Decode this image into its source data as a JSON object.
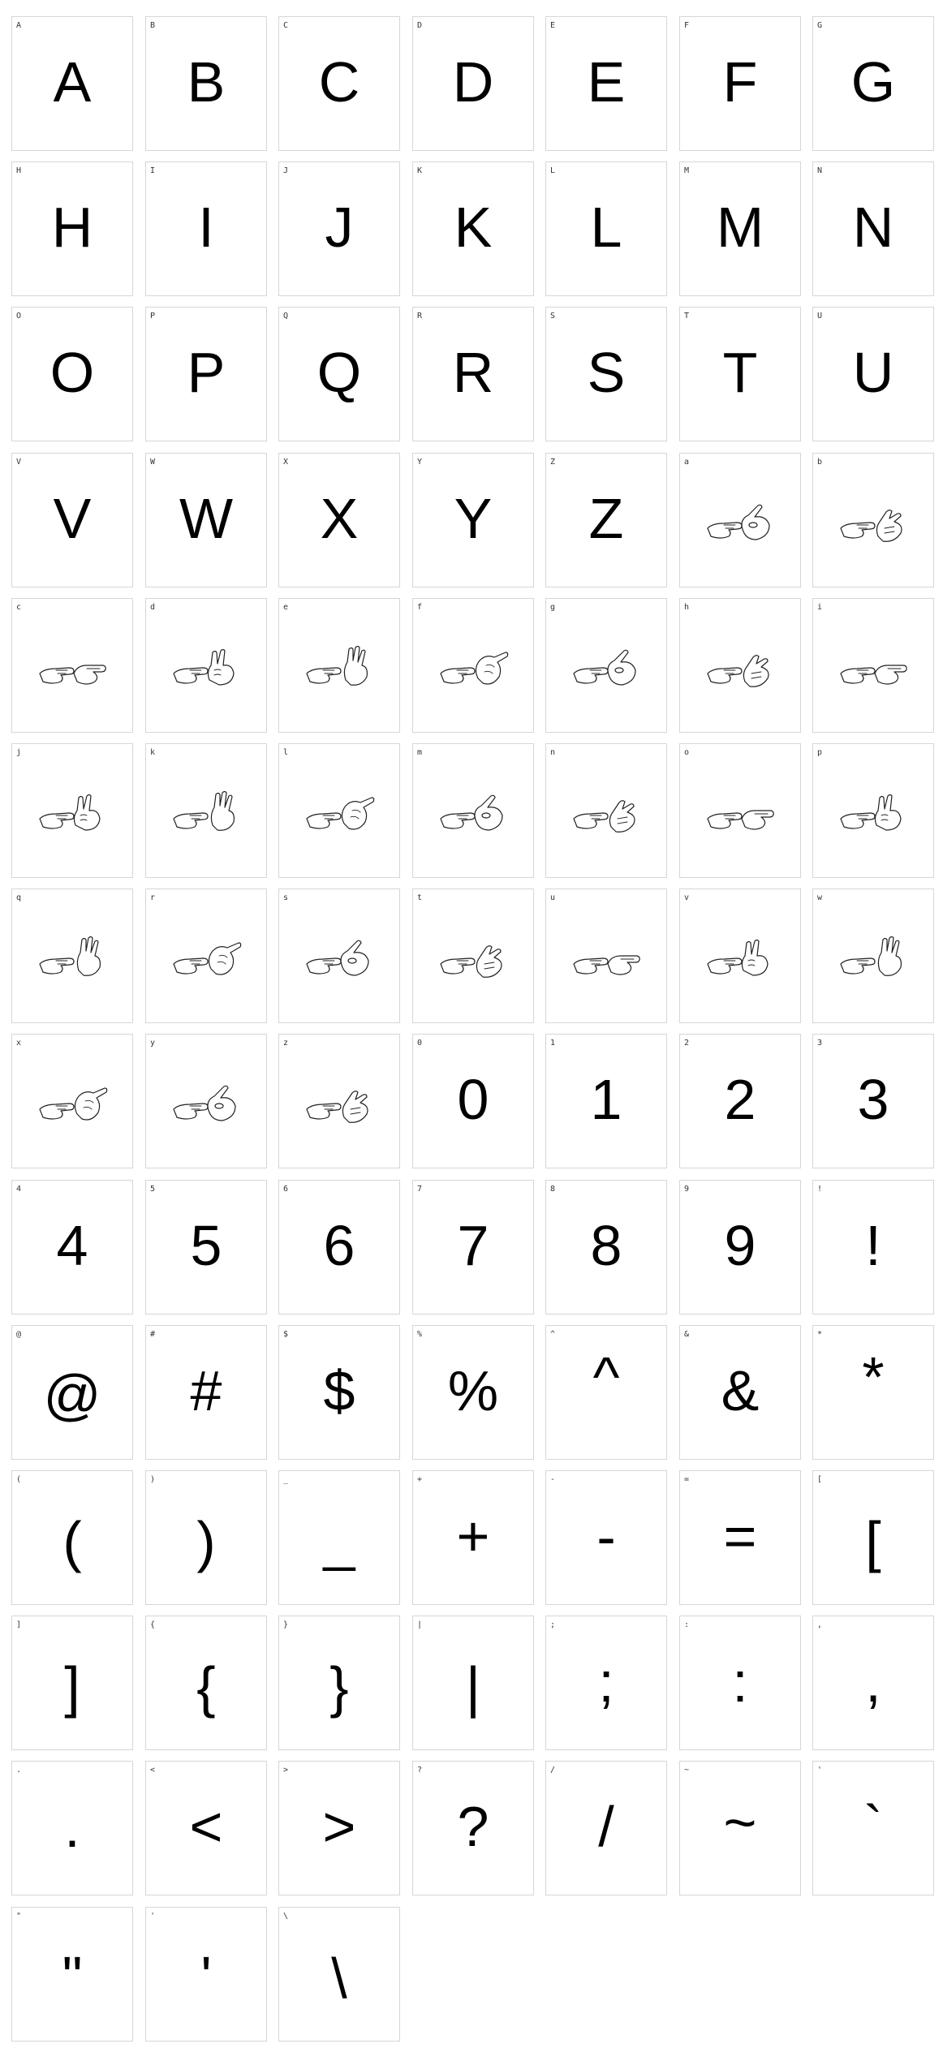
{
  "colors": {
    "background": "#ffffff",
    "cell_border": "#d6d6d6",
    "glyph": "#000000",
    "label": "#333333"
  },
  "cells": [
    {
      "label": "A",
      "glyph": "A"
    },
    {
      "label": "B",
      "glyph": "B"
    },
    {
      "label": "C",
      "glyph": "C"
    },
    {
      "label": "D",
      "glyph": "D"
    },
    {
      "label": "E",
      "glyph": "E"
    },
    {
      "label": "F",
      "glyph": "F"
    },
    {
      "label": "G",
      "glyph": "G"
    },
    {
      "label": "H",
      "glyph": "H"
    },
    {
      "label": "I",
      "glyph": "I"
    },
    {
      "label": "J",
      "glyph": "J"
    },
    {
      "label": "K",
      "glyph": "K"
    },
    {
      "label": "L",
      "glyph": "L"
    },
    {
      "label": "M",
      "glyph": "M"
    },
    {
      "label": "N",
      "glyph": "N"
    },
    {
      "label": "O",
      "glyph": "O"
    },
    {
      "label": "P",
      "glyph": "P"
    },
    {
      "label": "Q",
      "glyph": "Q"
    },
    {
      "label": "R",
      "glyph": "R"
    },
    {
      "label": "S",
      "glyph": "S"
    },
    {
      "label": "T",
      "glyph": "T"
    },
    {
      "label": "U",
      "glyph": "U"
    },
    {
      "label": "V",
      "glyph": "V"
    },
    {
      "label": "W",
      "glyph": "W"
    },
    {
      "label": "X",
      "glyph": "X"
    },
    {
      "label": "Y",
      "glyph": "Y"
    },
    {
      "label": "Z",
      "glyph": "Z"
    },
    {
      "label": "a",
      "icon": "hand-sign-a-icon"
    },
    {
      "label": "b",
      "icon": "hand-sign-b-icon"
    },
    {
      "label": "c",
      "icon": "hand-sign-c-icon"
    },
    {
      "label": "d",
      "icon": "hand-sign-d-icon"
    },
    {
      "label": "e",
      "icon": "hand-sign-e-icon"
    },
    {
      "label": "f",
      "icon": "hand-sign-f-icon"
    },
    {
      "label": "g",
      "icon": "hand-sign-g-icon"
    },
    {
      "label": "h",
      "icon": "hand-sign-h-icon"
    },
    {
      "label": "i",
      "icon": "hand-sign-i-icon"
    },
    {
      "label": "j",
      "icon": "hand-sign-j-icon"
    },
    {
      "label": "k",
      "icon": "hand-sign-k-icon"
    },
    {
      "label": "l",
      "icon": "hand-sign-l-icon"
    },
    {
      "label": "m",
      "icon": "hand-sign-m-icon"
    },
    {
      "label": "n",
      "icon": "hand-sign-n-icon"
    },
    {
      "label": "o",
      "icon": "hand-sign-o-icon"
    },
    {
      "label": "p",
      "icon": "hand-sign-p-icon"
    },
    {
      "label": "q",
      "icon": "hand-sign-q-icon"
    },
    {
      "label": "r",
      "icon": "hand-sign-r-icon"
    },
    {
      "label": "s",
      "icon": "hand-sign-s-icon"
    },
    {
      "label": "t",
      "icon": "hand-sign-t-icon"
    },
    {
      "label": "u",
      "icon": "hand-sign-u-icon"
    },
    {
      "label": "v",
      "icon": "hand-sign-v-icon"
    },
    {
      "label": "w",
      "icon": "hand-sign-w-icon"
    },
    {
      "label": "x",
      "icon": "hand-sign-x-icon"
    },
    {
      "label": "y",
      "icon": "hand-sign-y-icon"
    },
    {
      "label": "z",
      "icon": "hand-sign-z-icon"
    },
    {
      "label": "0",
      "glyph": "0"
    },
    {
      "label": "1",
      "glyph": "1"
    },
    {
      "label": "2",
      "glyph": "2"
    },
    {
      "label": "3",
      "glyph": "3"
    },
    {
      "label": "4",
      "glyph": "4"
    },
    {
      "label": "5",
      "glyph": "5"
    },
    {
      "label": "6",
      "glyph": "6"
    },
    {
      "label": "7",
      "glyph": "7"
    },
    {
      "label": "8",
      "glyph": "8"
    },
    {
      "label": "9",
      "glyph": "9"
    },
    {
      "label": "!",
      "glyph": "!"
    },
    {
      "label": "@",
      "glyph": "@"
    },
    {
      "label": "#",
      "glyph": "#"
    },
    {
      "label": "$",
      "glyph": "$"
    },
    {
      "label": "%",
      "glyph": "%"
    },
    {
      "label": "^",
      "glyph": "^"
    },
    {
      "label": "&",
      "glyph": "&"
    },
    {
      "label": "*",
      "glyph": "*"
    },
    {
      "label": "(",
      "glyph": "("
    },
    {
      "label": ")",
      "glyph": ")"
    },
    {
      "label": "_",
      "glyph": "_"
    },
    {
      "label": "+",
      "glyph": "+"
    },
    {
      "label": "-",
      "glyph": "-"
    },
    {
      "label": "=",
      "glyph": "="
    },
    {
      "label": "[",
      "glyph": "["
    },
    {
      "label": "]",
      "glyph": "]"
    },
    {
      "label": "{",
      "glyph": "{"
    },
    {
      "label": "}",
      "glyph": "}"
    },
    {
      "label": "|",
      "glyph": "|"
    },
    {
      "label": ";",
      "glyph": ";"
    },
    {
      "label": ":",
      "glyph": ":"
    },
    {
      "label": ",",
      "glyph": ","
    },
    {
      "label": ".",
      "glyph": "."
    },
    {
      "label": "<",
      "glyph": "<"
    },
    {
      "label": ">",
      "glyph": ">"
    },
    {
      "label": "?",
      "glyph": "?"
    },
    {
      "label": "/",
      "glyph": "/"
    },
    {
      "label": "~",
      "glyph": "~"
    },
    {
      "label": "'",
      "glyph": "`"
    },
    {
      "label": "\"",
      "glyph": "\""
    },
    {
      "label": "'",
      "glyph": "'"
    },
    {
      "label": "\\",
      "glyph": "\\"
    }
  ]
}
